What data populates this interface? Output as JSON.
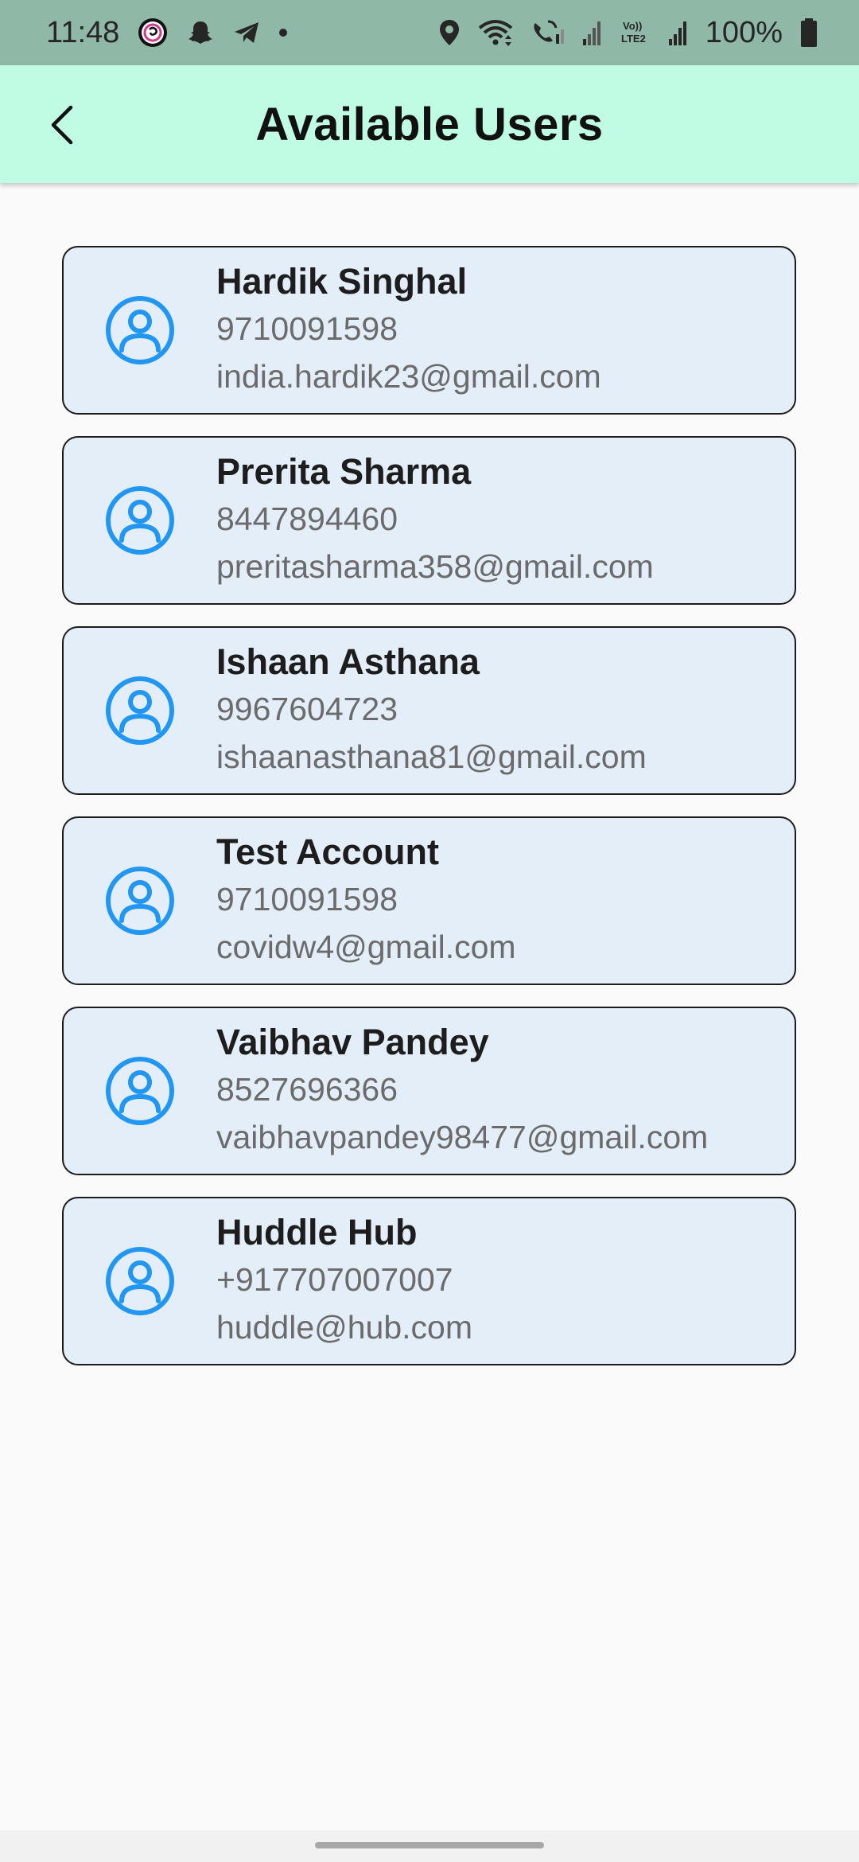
{
  "status_bar": {
    "time": "11:48",
    "battery_percent": "100%",
    "left_icons": [
      "threads-icon",
      "snapchat-icon",
      "telegram-icon",
      "dot-icon"
    ],
    "right_icons": [
      "location-icon",
      "wifi-icon",
      "wifi-call-icon",
      "signal-icon",
      "volte-icon",
      "signal-icon",
      "battery-icon"
    ],
    "background": "#8fb8a6"
  },
  "app_bar": {
    "title": "Available Users",
    "back_icon": "chevron-left-icon",
    "background": "#c0fbe4"
  },
  "users": [
    {
      "name": "Hardik Singhal",
      "phone": "9710091598",
      "email": "india.hardik23@gmail.com"
    },
    {
      "name": "Prerita Sharma",
      "phone": "8447894460",
      "email": "preritasharma358@gmail.com"
    },
    {
      "name": "Ishaan Asthana",
      "phone": "9967604723",
      "email": "ishaanasthana81@gmail.com"
    },
    {
      "name": "Test Account",
      "phone": "9710091598",
      "email": "covidw4@gmail.com"
    },
    {
      "name": "Vaibhav Pandey",
      "phone": "8527696366",
      "email": "vaibhavpandey98477@gmail.com"
    },
    {
      "name": "Huddle Hub",
      "phone": "+917707007007",
      "email": "huddle@hub.com"
    }
  ],
  "colors": {
    "card_background": "#e3eef9",
    "avatar_icon": "#2196f3",
    "name_text": "#1d1d1d",
    "detail_text": "#6b6b6b"
  }
}
